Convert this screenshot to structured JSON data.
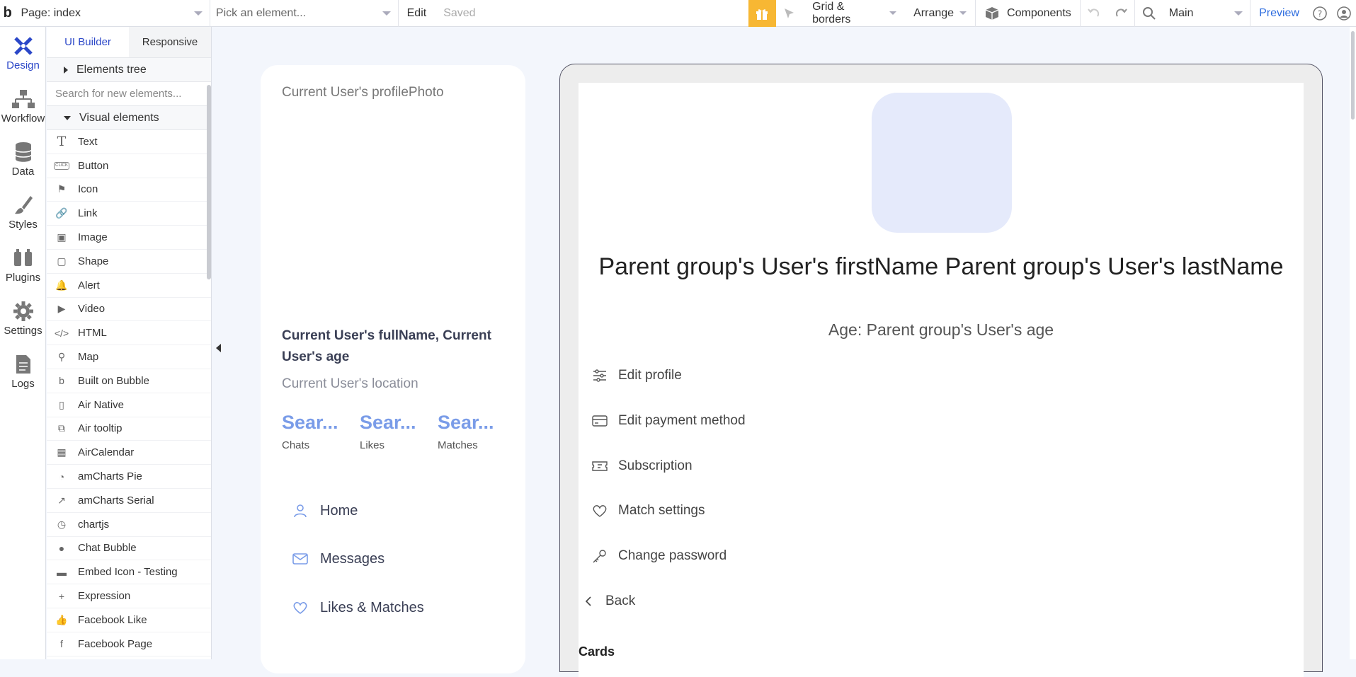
{
  "topbar": {
    "logo": "b",
    "page_select": "Page: index",
    "element_picker_placeholder": "Pick an element...",
    "edit_label": "Edit",
    "saved_label": "Saved",
    "grid_borders": "Grid & borders",
    "arrange": "Arrange",
    "components": "Components",
    "branch": "Main",
    "preview": "Preview"
  },
  "rail": {
    "items": [
      {
        "label": "Design"
      },
      {
        "label": "Workflow"
      },
      {
        "label": "Data"
      },
      {
        "label": "Styles"
      },
      {
        "label": "Plugins"
      },
      {
        "label": "Settings"
      },
      {
        "label": "Logs"
      }
    ]
  },
  "panel": {
    "tabs": [
      "UI Builder",
      "Responsive"
    ],
    "elements_tree": "Elements tree",
    "search_placeholder": "Search for new elements...",
    "visual_elements": "Visual elements",
    "items": [
      {
        "label": "Text",
        "icon": "T"
      },
      {
        "label": "Button",
        "icon": "CLICK"
      },
      {
        "label": "Icon",
        "icon": "⚑"
      },
      {
        "label": "Link",
        "icon": "🔗"
      },
      {
        "label": "Image",
        "icon": "▣"
      },
      {
        "label": "Shape",
        "icon": "▢"
      },
      {
        "label": "Alert",
        "icon": "🔔"
      },
      {
        "label": "Video",
        "icon": "▶"
      },
      {
        "label": "HTML",
        "icon": "</>"
      },
      {
        "label": "Map",
        "icon": "⚲"
      },
      {
        "label": "Built on Bubble",
        "icon": "b"
      },
      {
        "label": "Air Native",
        "icon": "▯"
      },
      {
        "label": "Air tooltip",
        "icon": "⧉"
      },
      {
        "label": "AirCalendar",
        "icon": "▦"
      },
      {
        "label": "amCharts Pie",
        "icon": "◔"
      },
      {
        "label": "amCharts Serial",
        "icon": "↗"
      },
      {
        "label": "chartjs",
        "icon": "◷"
      },
      {
        "label": "Chat Bubble",
        "icon": "●"
      },
      {
        "label": "Embed Icon - Testing",
        "icon": "▬"
      },
      {
        "label": "Expression",
        "icon": "+"
      },
      {
        "label": "Facebook Like",
        "icon": "👍"
      },
      {
        "label": "Facebook Page",
        "icon": "f"
      }
    ]
  },
  "left_card": {
    "photo_label": "Current User's profilePhoto",
    "fullname": "Current User's fullName, Current User's age",
    "location": "Current User's location",
    "stats": [
      {
        "value": "Sear...",
        "label": "Chats"
      },
      {
        "value": "Sear...",
        "label": "Likes"
      },
      {
        "value": "Sear...",
        "label": "Matches"
      }
    ],
    "nav": [
      {
        "label": "Home"
      },
      {
        "label": "Messages"
      },
      {
        "label": "Likes & Matches"
      }
    ]
  },
  "profile": {
    "name": "Parent group's User's firstName Parent group's User's lastName",
    "age": "Age: Parent group's User's age",
    "menu": [
      {
        "label": "Edit profile"
      },
      {
        "label": "Edit payment method"
      },
      {
        "label": "Subscription"
      },
      {
        "label": "Match settings"
      },
      {
        "label": "Change password"
      }
    ],
    "back": "Back",
    "cards_heading": "Cards"
  },
  "colors": {
    "accent": "#2b47c8",
    "gift": "#f7b733",
    "stat": "#7a9ce8",
    "avatar_bg": "#e5eafb"
  }
}
